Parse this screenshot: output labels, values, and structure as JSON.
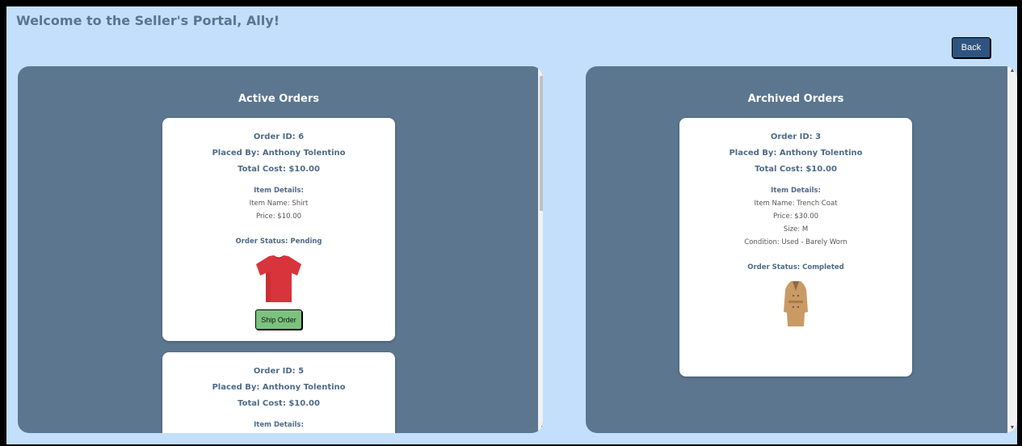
{
  "header": {
    "welcome": "Welcome to the Seller's Portal, Ally!"
  },
  "back_label": "Back",
  "active": {
    "title": "Active Orders",
    "orders": [
      {
        "order_id": "Order ID: 6",
        "placed_by": "Placed By: Anthony Tolentino",
        "total": "Total Cost: $10.00",
        "details_heading": "Item Details:",
        "item_name": "Item Name: Shirt",
        "price": "Price: $10.00",
        "status": "Order Status: Pending",
        "image_icon": "red-tshirt-icon",
        "action_label": "Ship Order"
      },
      {
        "order_id": "Order ID: 5",
        "placed_by": "Placed By: Anthony Tolentino",
        "total": "Total Cost: $10.00",
        "details_heading": "Item Details:"
      }
    ]
  },
  "archived": {
    "title": "Archived Orders",
    "orders": [
      {
        "order_id": "Order ID: 3",
        "placed_by": "Placed By: Anthony Tolentino",
        "total": "Total Cost: $10.00",
        "details_heading": "Item Details:",
        "item_name": "Item Name: Trench Coat",
        "price": "Price: $30.00",
        "size": "Size: M",
        "condition": "Condition: Used - Barely Worn",
        "status": "Order Status: Completed",
        "image_icon": "trench-coat-icon"
      }
    ]
  },
  "colors": {
    "background": "#c3dffb",
    "panel": "#5c768f",
    "back_button": "#2f5480",
    "ship_button": "#7cc27e",
    "text_accent": "#4d6a87"
  }
}
